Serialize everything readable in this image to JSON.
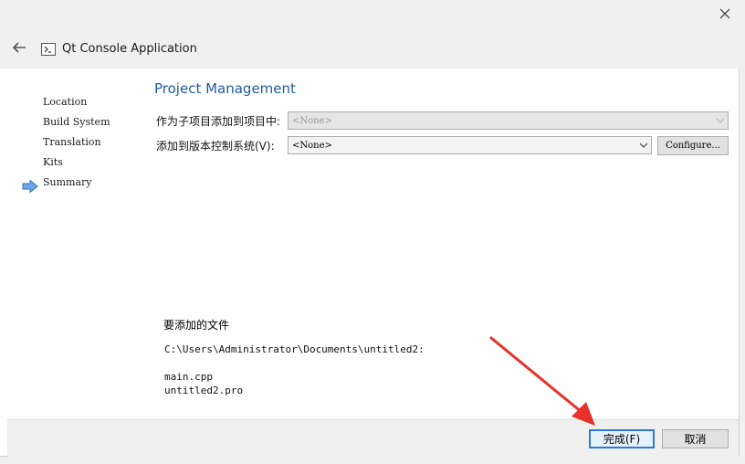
{
  "window": {
    "title": "Qt Console Application",
    "back_icon": "arrow-left-icon",
    "app_icon": "console-icon",
    "close_icon": "close-icon"
  },
  "sidebar": {
    "items": [
      {
        "label": "Location",
        "active": false
      },
      {
        "label": "Build System",
        "active": false
      },
      {
        "label": "Translation",
        "active": false
      },
      {
        "label": "Kits",
        "active": false
      },
      {
        "label": "Summary",
        "active": true
      }
    ],
    "active_marker_color": "#4a90d9"
  },
  "main": {
    "title": "Project Management",
    "add_as_subproject": {
      "label": "作为子项目添加到项目中:",
      "value": "<None>",
      "enabled": false
    },
    "version_control": {
      "label": "添加到版本控制系统(V):",
      "value": "<None>",
      "enabled": true,
      "configure_label": "Configure..."
    },
    "files": {
      "title": "要添加的文件",
      "directory": "C:\\Users\\Administrator\\Documents\\untitled2:",
      "list": [
        "main.cpp",
        "untitled2.pro"
      ]
    }
  },
  "footer": {
    "finish_label": "完成(F)",
    "cancel_label": "取消"
  },
  "colors": {
    "title_blue": "#1f5ba3",
    "annotation_red": "#e8312a",
    "primary_border": "#2f7ad6"
  }
}
